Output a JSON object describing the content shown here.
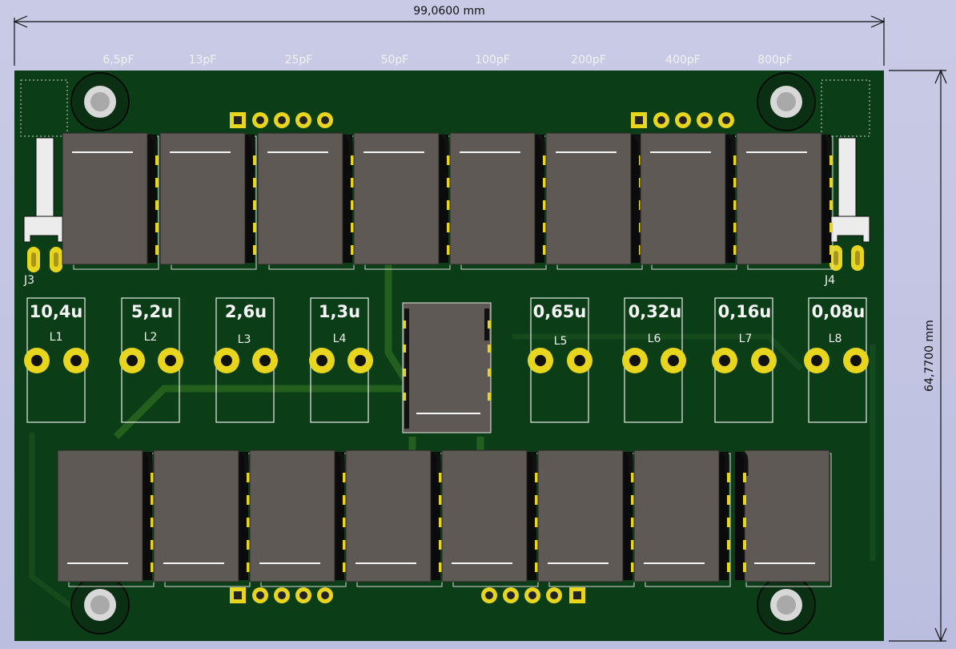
{
  "dimensions": {
    "width_label": "99,0600 mm",
    "height_label": "64,7700 mm"
  },
  "capacitor_labels": [
    "6,5pF",
    "13pF",
    "25pF",
    "50pF",
    "100pF",
    "200pF",
    "400pF",
    "800pF"
  ],
  "inductors": [
    {
      "value": "10,4u",
      "ref": "L1"
    },
    {
      "value": "5,2u",
      "ref": "L2"
    },
    {
      "value": "2,6u",
      "ref": "L3"
    },
    {
      "value": "1,3u",
      "ref": "L4"
    },
    {
      "value": "0,65u",
      "ref": "L5"
    },
    {
      "value": "0,32u",
      "ref": "L6"
    },
    {
      "value": "0,16u",
      "ref": "L7"
    },
    {
      "value": "0,08u",
      "ref": "L8"
    }
  ],
  "connectors": {
    "left": "J3",
    "right": "J4"
  },
  "colors": {
    "board": "#0b3d17",
    "silk": "#f2f2f2",
    "pad": "#e8d61e",
    "relay_body": "#5e5955",
    "background": "#c4c6e3",
    "trace": "#2e6b22"
  }
}
